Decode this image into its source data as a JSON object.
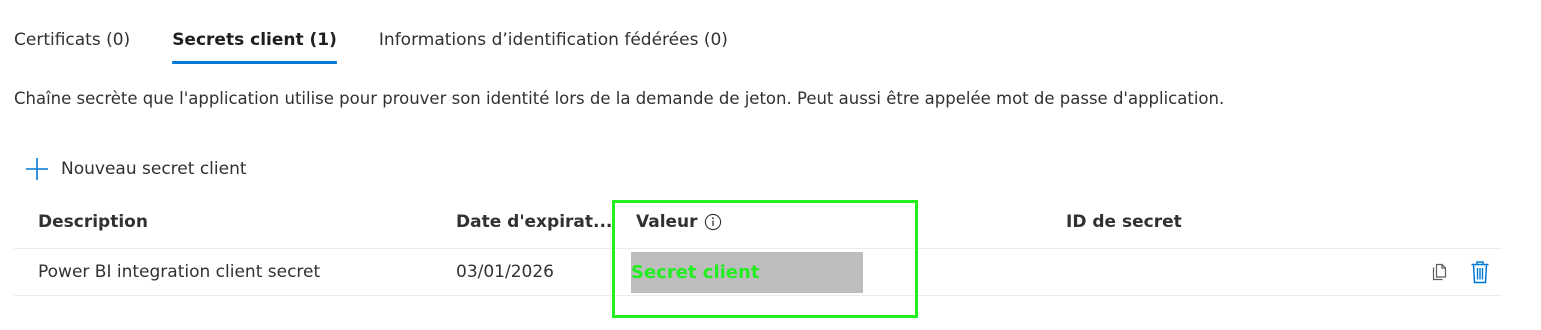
{
  "tabs": [
    {
      "label": "Certificats (0)",
      "active": false
    },
    {
      "label": "Secrets client (1)",
      "active": true
    },
    {
      "label": "Informations d’identification fédérées (0)",
      "active": false
    }
  ],
  "description": "Chaîne secrète que l'application utilise pour prouver son identité lors de la demande de jeton. Peut aussi être appelée mot de passe d'application.",
  "new_secret": {
    "label": "Nouveau secret client",
    "icon": "plus-icon"
  },
  "table": {
    "headers": {
      "description": "Description",
      "expiration": "Date d'expirat...",
      "value": "Valeur",
      "secret_id": "ID de secret"
    },
    "rows": [
      {
        "description": "Power BI integration client secret",
        "expiration": "03/01/2026",
        "value": "",
        "secret_id": ""
      }
    ]
  },
  "annotation": {
    "label": "Secret client"
  },
  "colors": {
    "accent": "#0078d4",
    "annotation": "#22ee22",
    "mask": "#bdbdbd",
    "text": "#323130"
  },
  "icons": {
    "info": "info-icon",
    "copy": "copy-icon",
    "delete": "delete-icon"
  }
}
